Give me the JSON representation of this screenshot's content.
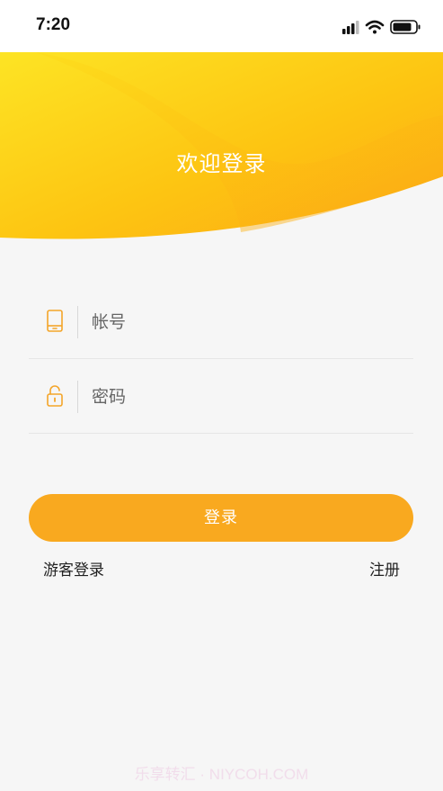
{
  "status_bar": {
    "time": "7:20",
    "icons": [
      "cellular-signal-icon",
      "wifi-icon",
      "battery-icon"
    ]
  },
  "header": {
    "title": "欢迎登录"
  },
  "form": {
    "account_placeholder": "帐号",
    "password_placeholder": "密码",
    "account_icon": "phone-icon",
    "password_icon": "lock-icon"
  },
  "actions": {
    "login_label": "登录",
    "guest_login_label": "游客登录",
    "register_label": "注册"
  },
  "watermark": "乐享转汇 · NIYCOH.COM",
  "colors": {
    "accent": "#f9a91f",
    "header_yellow": "#fdd20f",
    "header_orange": "#fca613",
    "icon_orange": "#f4a529",
    "background": "#f6f6f6"
  }
}
